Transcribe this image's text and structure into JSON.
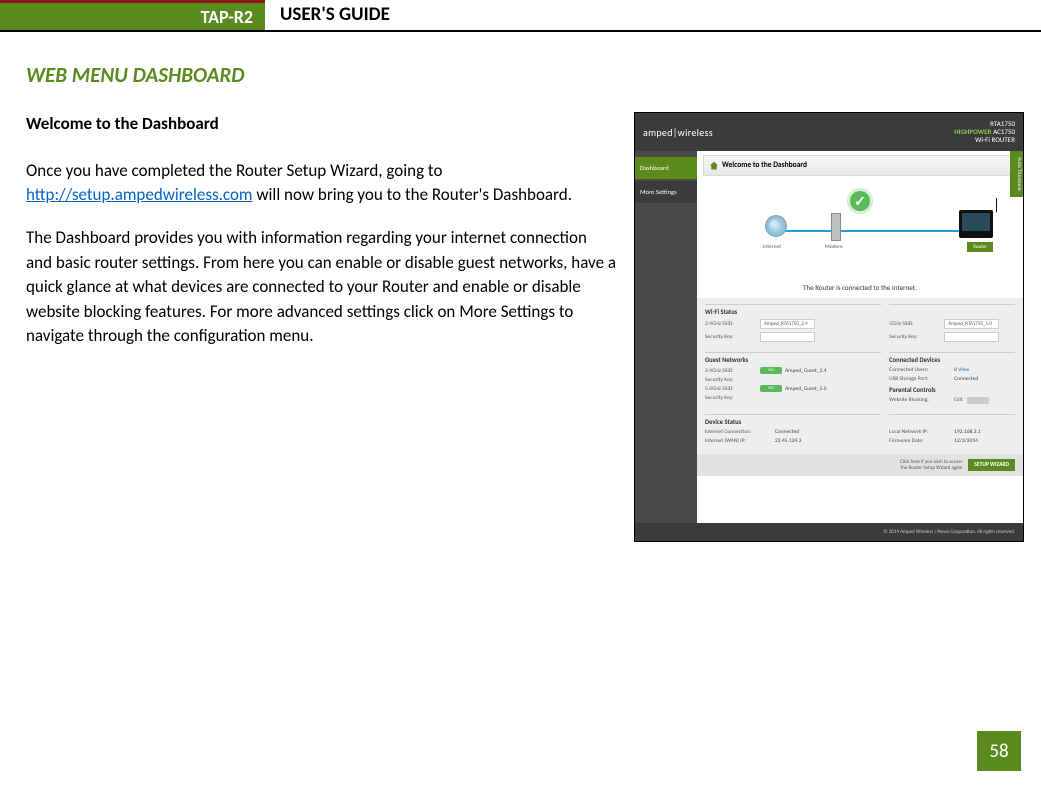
{
  "header": {
    "product": "TAP-R2",
    "title": "USER'S GUIDE"
  },
  "section_title": "WEB MENU DASHBOARD",
  "subheading": "Welcome to the Dashboard",
  "para1_prefix": "Once you have completed the Router Setup Wizard, going to ",
  "para1_link": "http://setup.ampedwireless.com",
  "para1_suffix": " will now bring you to the Router's Dashboard.",
  "para2": "The Dashboard provides you with information regarding your internet connection and basic router settings. From here you can enable or disable guest networks, have a quick glance at what devices are connected to your Router and enable or disable website blocking features. For more advanced settings click on More Settings to navigate through the configuration menu.",
  "page_number": "58",
  "screenshot": {
    "brand": "amped|wireless",
    "model_code": "RTA1750",
    "model_label_hp": "HIGHPOWER",
    "model_label_rest": " AC1750",
    "model_label2": "Wi-Fi ROUTER",
    "side": {
      "dashboard": "Dashboard",
      "more": "More Settings"
    },
    "welcome": "Welcome to the Dashboard",
    "diagram": {
      "internet": "Internet",
      "modem": "Modem",
      "router": "Router"
    },
    "connected": "The Router is connected to the Internet.",
    "side_tab": "Auto Timezone",
    "wifi_status": {
      "title": "Wi-Fi Status",
      "ssid24_k": "2.4GHz SSID:",
      "ssid24_v": "Amped_RTA1750_2.4",
      "ssid5_k": "5GHz SSID:",
      "ssid5_v": "Amped_RTA1750_5.0",
      "sec24_k": "Security Key:",
      "sec5_k": "Security Key:"
    },
    "guest": {
      "title": "Guest Networks",
      "g24_k": "2.4GHz SSID:",
      "g24_v": "Amped_Guest_2.4",
      "g5_k": "5.0GHz SSID:",
      "g5_v": "Amped_Guest_5.0",
      "sec_k": "Security Key:",
      "on": "ON"
    },
    "connected_dev": {
      "title": "Connected Devices",
      "users_k": "Connected Users:",
      "users_v": "8 View",
      "usb_k": "USB Storage Port:",
      "usb_v": "Connected"
    },
    "parental": {
      "title": "Parental Controls",
      "block_k": "Website Blocking:",
      "block_v": "Edit"
    },
    "device_status": {
      "title": "Device Status",
      "ic_k": "Internet Connection:",
      "ic_v": "Connected",
      "wan_k": "Internet (WAN) IP:",
      "wan_v": "22.45.124.3",
      "lan_k": "Local Network IP:",
      "lan_v": "192.168.3.1",
      "fw_k": "Firmware Date:",
      "fw_v": "12/3/2014"
    },
    "setup_note1": "Click here if you wish to access",
    "setup_note2": "the Router Setup Wizard again",
    "setup_btn": "SETUP WIZARD",
    "footer": "© 2014 Amped Wireless / Newo Corporation. All rights reserved."
  }
}
